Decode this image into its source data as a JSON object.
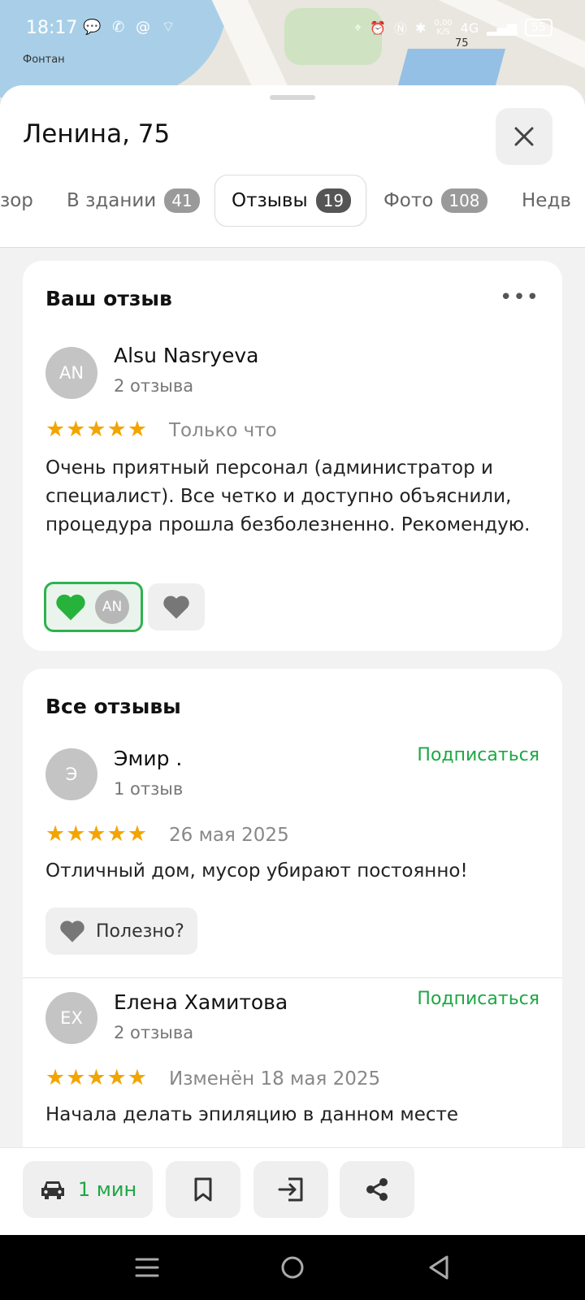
{
  "status_bar": {
    "time": "18:17",
    "left_icons": "💬 ✆ @ ⌔",
    "net_speed_value": "0,00",
    "net_speed_unit": "K/S",
    "network": "4G",
    "battery": "55"
  },
  "map": {
    "label_fountain": "Фонтан",
    "label_number": "75"
  },
  "sheet": {
    "title": "Ленина, 75",
    "tabs": [
      {
        "label": "зор",
        "count": ""
      },
      {
        "label": "В здании",
        "count": "41"
      },
      {
        "label": "Отзывы",
        "count": "19"
      },
      {
        "label": "Фото",
        "count": "108"
      },
      {
        "label": "Недв",
        "count": ""
      }
    ]
  },
  "my_review": {
    "title": "Ваш отзыв",
    "more": "•••",
    "avatar": "AN",
    "author": "Alsu Nasryeva",
    "count": "2 отзыва",
    "stars": "★★★★★",
    "date": "Только что",
    "text": "Очень приятный персонал (администратор и специалист). Все четко и доступно объяснили, процедура прошла безболезненно. Рекомендую.",
    "reaction_avatar": "AN"
  },
  "all_reviews": {
    "title": "Все отзывы",
    "items": [
      {
        "avatar": "Э",
        "author": "Эмир .",
        "count": "1 отзыв",
        "subscribe": "Подписаться",
        "stars": "★★★★★",
        "date": "26 мая 2025",
        "text": "Отличный дом, мусор убирают постоянно!",
        "useful": "Полезно?"
      },
      {
        "avatar": "ЕХ",
        "author": "Елена Хамитова",
        "count": "2 отзыва",
        "subscribe": "Подписаться",
        "stars": "★★★★★",
        "date": "Изменён 18 мая 2025",
        "text": "Начала делать эпиляцию в данном месте"
      }
    ]
  },
  "actions": {
    "drive_time": "1 мин"
  },
  "colors": {
    "accent_green": "#1ea745",
    "star": "#f2a500"
  }
}
